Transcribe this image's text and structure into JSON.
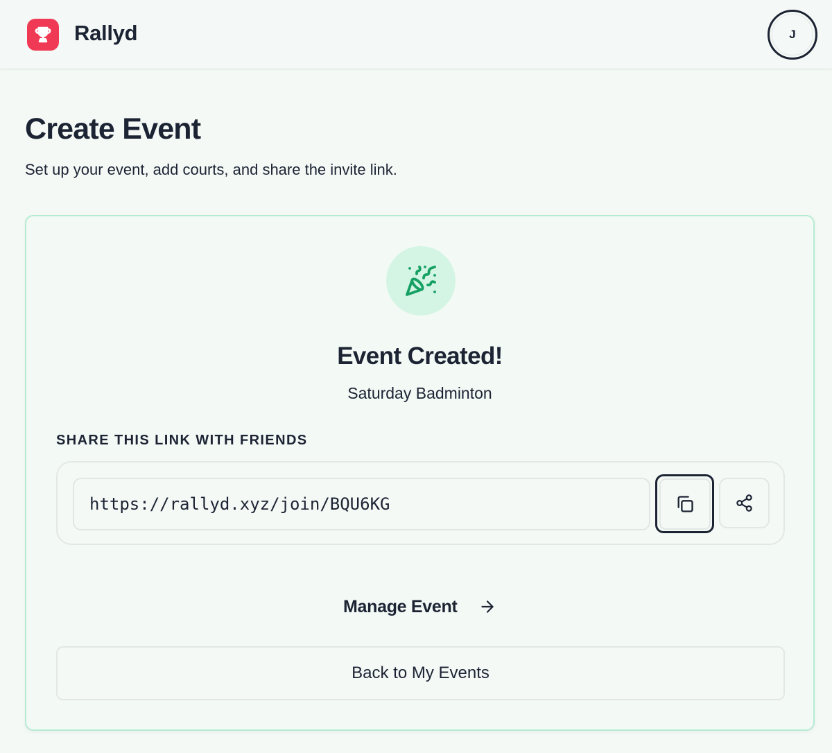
{
  "header": {
    "brand": "Rallyd",
    "avatar_initial": "J"
  },
  "page": {
    "title": "Create Event",
    "subtitle": "Set up your event, add courts, and share the invite link."
  },
  "card": {
    "icon": "party-popper-icon",
    "title": "Event Created!",
    "event_name": "Saturday Badminton",
    "share_label": "SHARE THIS LINK WITH FRIENDS",
    "invite_link": "https://rallyd.xyz/join/BQU6KG",
    "copy_icon": "copy-icon",
    "share_icon": "share-icon",
    "manage_label": "Manage Event",
    "back_label": "Back to My Events"
  },
  "colors": {
    "brand": "#f03a55",
    "success": "#15a064",
    "success_bg": "#d4f5e4",
    "card_border": "#b6ecd2",
    "text": "#1c2333"
  }
}
